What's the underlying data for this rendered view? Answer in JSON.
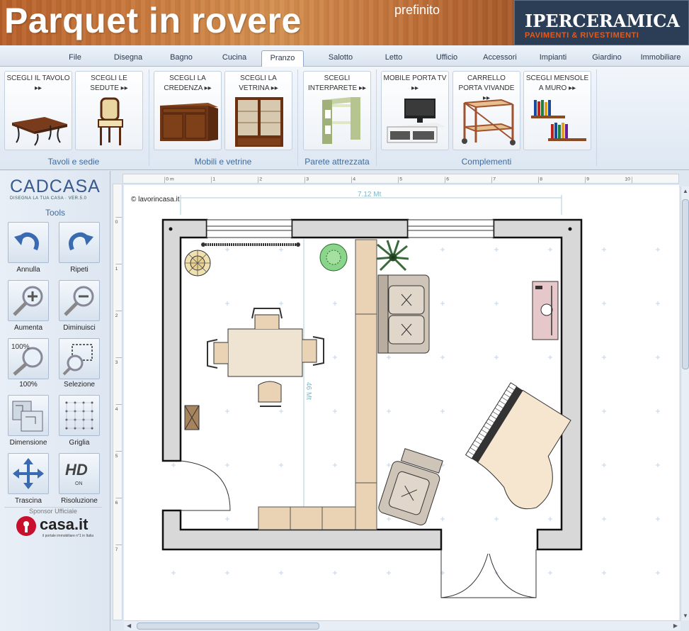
{
  "banner": {
    "title": "Parquet in rovere",
    "subtitle": "prefinito",
    "brand": "IPERCERAMICA",
    "brand_tag": "PAVIMENTI & RIVESTIMENTI"
  },
  "menu": {
    "tabs": [
      "File",
      "Disegna",
      "Bagno",
      "Cucina",
      "Pranzo",
      "Salotto",
      "Letto",
      "Ufficio",
      "Accessori",
      "Impianti",
      "Giardino",
      "Immobiliare"
    ],
    "active": "Pranzo"
  },
  "ribbon": {
    "buttons": [
      {
        "label": "SCEGLI IL TAVOLO",
        "icon": "table-icon"
      },
      {
        "label": "SCEGLI LE SEDUTE",
        "icon": "chair-icon"
      },
      {
        "label": "SCEGLI LA CREDENZA",
        "icon": "sideboard-icon"
      },
      {
        "label": "SCEGLI LA VETRINA",
        "icon": "vitrine-icon"
      },
      {
        "label": "SCEGLI INTERPARETE",
        "icon": "wall-unit-icon"
      },
      {
        "label": "MOBILE PORTA TV",
        "icon": "tv-stand-icon"
      },
      {
        "label": "CARRELLO PORTA VIVANDE",
        "icon": "trolley-icon"
      },
      {
        "label": "SCEGLI MENSOLE A MURO",
        "icon": "shelves-icon"
      }
    ],
    "groups": [
      "Tavoli e sedie",
      "Mobili e vetrine",
      "Parete attrezzata",
      "Complementi"
    ]
  },
  "left": {
    "logo": "CADCASA",
    "logo_sub": "DISEGNA LA TUA CASA · VER.5.0",
    "tools_title": "Tools",
    "tools": [
      {
        "label": "Annulla",
        "icon": "undo-icon"
      },
      {
        "label": "Ripeti",
        "icon": "redo-icon"
      },
      {
        "label": "Aumenta",
        "icon": "zoom-in-icon"
      },
      {
        "label": "Diminuisci",
        "icon": "zoom-out-icon"
      },
      {
        "label": "100%",
        "icon": "zoom-100-icon"
      },
      {
        "label": "Selezione",
        "icon": "selection-icon"
      },
      {
        "label": "Dimensione",
        "icon": "dimension-icon"
      },
      {
        "label": "Griglia",
        "icon": "grid-icon"
      },
      {
        "label": "Trascina",
        "icon": "move-icon"
      },
      {
        "label": "Risoluzione",
        "icon": "hd-icon"
      }
    ],
    "hd_state": "ON",
    "sponsor_label": "Sponsor Ufficiale",
    "sponsor_name": "casa.it",
    "sponsor_tag": "il portale immobiliare n°1 in Italia"
  },
  "canvas": {
    "copyright": "© lavorincasa.it",
    "dimension_h": "7.12 Mt",
    "dimension_v": "46 Mt",
    "ruler_labels": [
      "0 m",
      "1",
      "2",
      "3",
      "4",
      "5",
      "6",
      "7",
      "8",
      "9",
      "10"
    ],
    "vruler_labels": [
      "0",
      "1",
      "2",
      "3",
      "4",
      "5",
      "6",
      "7"
    ]
  }
}
